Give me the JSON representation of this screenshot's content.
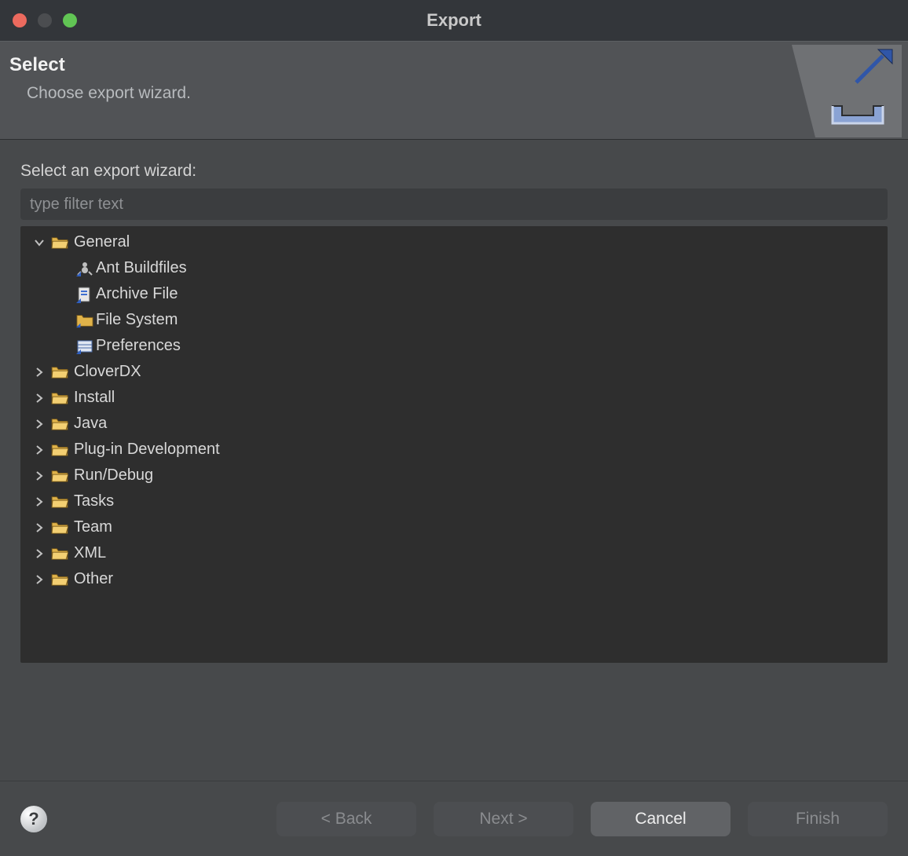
{
  "window": {
    "title": "Export"
  },
  "header": {
    "title": "Select",
    "subtitle": "Choose export wizard."
  },
  "main": {
    "field_label": "Select an export wizard:",
    "filter_placeholder": "type filter text",
    "tree": [
      {
        "label": "General",
        "expanded": true,
        "children": [
          {
            "label": "Ant Buildfiles",
            "icon": "ant"
          },
          {
            "label": "Archive File",
            "icon": "archive"
          },
          {
            "label": "File System",
            "icon": "folder-base"
          },
          {
            "label": "Preferences",
            "icon": "prefs"
          }
        ]
      },
      {
        "label": "CloverDX",
        "expanded": false
      },
      {
        "label": "Install",
        "expanded": false
      },
      {
        "label": "Java",
        "expanded": false
      },
      {
        "label": "Plug-in Development",
        "expanded": false
      },
      {
        "label": "Run/Debug",
        "expanded": false
      },
      {
        "label": "Tasks",
        "expanded": false
      },
      {
        "label": "Team",
        "expanded": false
      },
      {
        "label": "XML",
        "expanded": false
      },
      {
        "label": "Other",
        "expanded": false
      }
    ]
  },
  "footer": {
    "back": "< Back",
    "next": "Next >",
    "cancel": "Cancel",
    "finish": "Finish"
  }
}
